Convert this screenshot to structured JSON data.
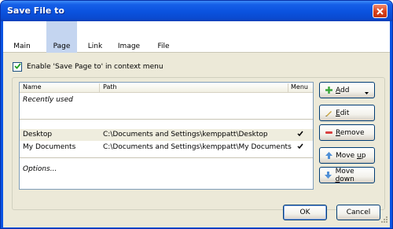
{
  "window": {
    "title": "Save File to"
  },
  "tabs": [
    {
      "label": "Main"
    },
    {
      "label": "Page",
      "active": true
    },
    {
      "label": "Link"
    },
    {
      "label": "Image"
    },
    {
      "label": "File"
    }
  ],
  "option": {
    "enable_label": "Enable 'Save Page to' in context menu",
    "checked": true
  },
  "list": {
    "columns": {
      "name": "Name",
      "path": "Path",
      "menu": "Menu"
    },
    "recently_used": "Recently used",
    "rows": [
      {
        "name": "Desktop",
        "path": "C:\\Documents and Settings\\kemppatt\\Desktop",
        "menu": true
      },
      {
        "name": "My Documents",
        "path": "C:\\Documents and Settings\\kemppatt\\My Documents",
        "menu": true
      }
    ],
    "options": "Options..."
  },
  "side_buttons": {
    "add": {
      "prefix": "",
      "underline": "A",
      "rest": "dd"
    },
    "edit": {
      "prefix": "",
      "underline": "E",
      "rest": "dit"
    },
    "remove": {
      "prefix": "",
      "underline": "R",
      "rest": "emove"
    },
    "move_up": {
      "prefix": "Move ",
      "underline": "u",
      "rest": "p"
    },
    "move_down": {
      "prefix": "Move ",
      "underline": "d",
      "rest": "own"
    }
  },
  "footer": {
    "ok": "OK",
    "cancel": "Cancel"
  },
  "colors": {
    "titlebar": "#0a52de",
    "active_tab": "#c4d5f0",
    "dialog_bg": "#ece9d8",
    "checkmark": "#21a121"
  },
  "icons": {
    "close": "close-icon",
    "add": "plus-icon",
    "edit": "pencil-icon",
    "remove": "minus-icon",
    "move_up": "arrow-up-icon",
    "move_down": "arrow-down-icon"
  }
}
